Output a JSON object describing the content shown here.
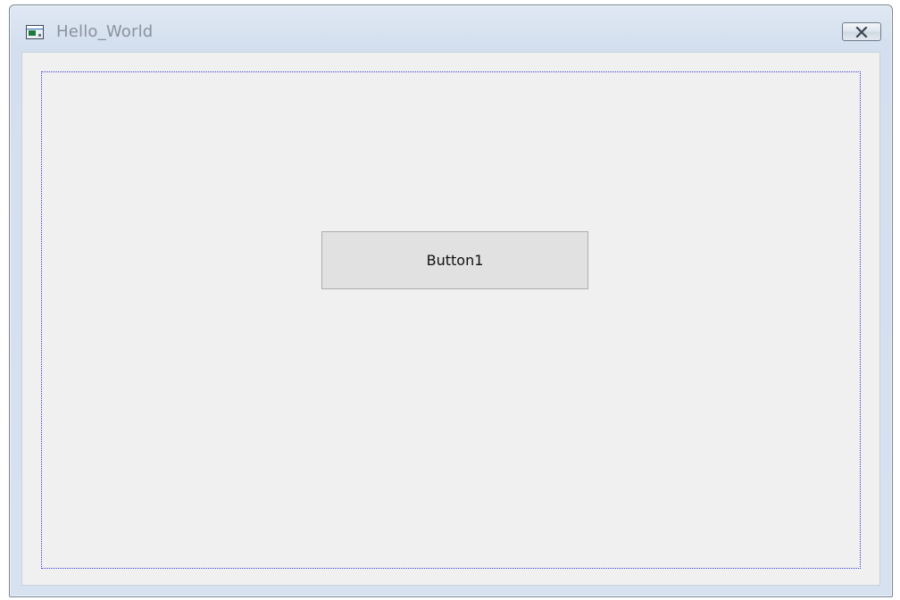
{
  "window": {
    "title": "Hello_World",
    "app_icon": "application-window-icon",
    "close_icon": "close-x-icon"
  },
  "client": {
    "button1_label": "Button1"
  },
  "colors": {
    "titlebar": "#d3dfee",
    "client_background": "#f0f0f0",
    "button_background": "#e1e1e1",
    "focus_frame": "#3a3ad8",
    "title_text": "#8a929c"
  }
}
